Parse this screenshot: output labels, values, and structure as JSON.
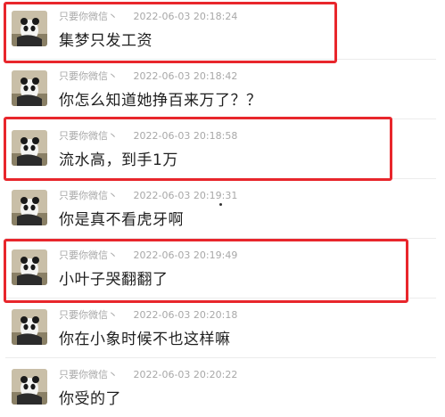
{
  "messages": [
    {
      "name": "只要你微信丶",
      "time": "2022-06-03 20:18:24",
      "text": "集梦只发工资",
      "highlighted": true
    },
    {
      "name": "只要你微信丶",
      "time": "2022-06-03 20:18:42",
      "text": "你怎么知道她挣百来万了？？",
      "highlighted": false
    },
    {
      "name": "只要你微信丶",
      "time": "2022-06-03 20:18:58",
      "text": "流水高，到手1万",
      "highlighted": true
    },
    {
      "name": "只要你微信丶",
      "time": "2022-06-03 20:19:31",
      "text": "你是真不看虎牙啊",
      "highlighted": false
    },
    {
      "name": "只要你微信丶",
      "time": "2022-06-03 20:19:49",
      "text": "小叶子哭翻翻了",
      "highlighted": true
    },
    {
      "name": "只要你微信丶",
      "time": "2022-06-03 20:20:18",
      "text": "你在小象时候不也这样嘛",
      "highlighted": false
    },
    {
      "name": "只要你微信丶",
      "time": "2022-06-03 20:20:22",
      "text": "你受的了",
      "highlighted": false
    }
  ],
  "colors": {
    "highlight": "#e8262c",
    "meta_text": "#a8a8a8",
    "message_text": "#1f1f1f"
  }
}
